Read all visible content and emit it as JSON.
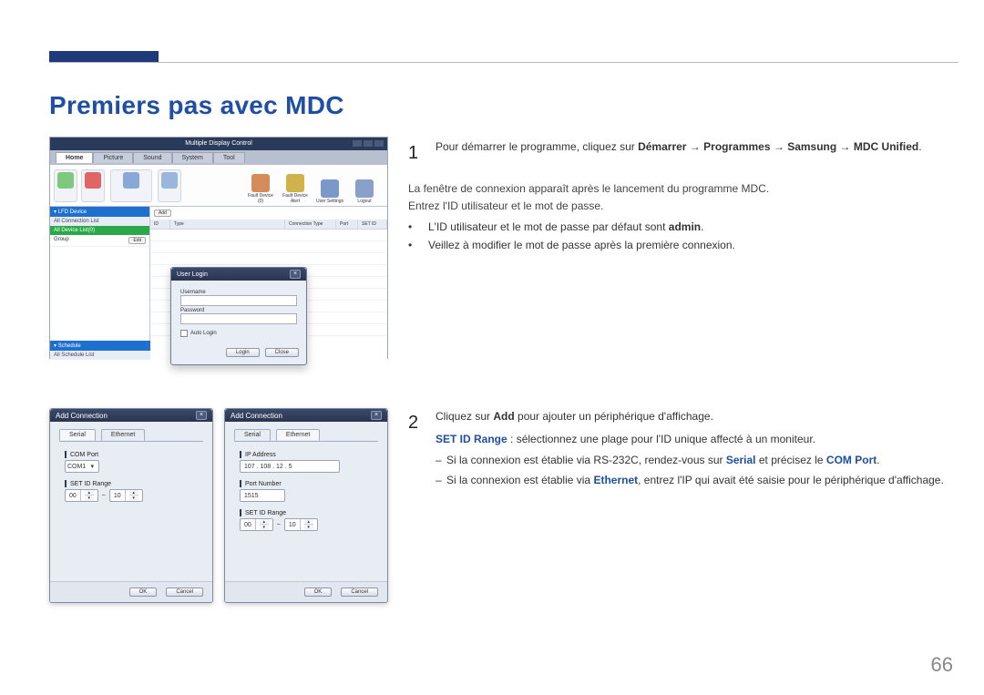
{
  "page": {
    "title": "Premiers pas avec MDC",
    "number": "66"
  },
  "mdc": {
    "window_title": "Multiple Display Control",
    "tabs": [
      "Home",
      "Picture",
      "Sound",
      "System",
      "Tool"
    ],
    "toolbar_right": [
      {
        "label": "Fault Device (0)"
      },
      {
        "label": "Fault Device Alert"
      },
      {
        "label": "User Settings"
      },
      {
        "label": "Logout"
      }
    ],
    "side": {
      "lfd_header": "▾ LFD Device",
      "conn_list": "All Connection List",
      "all_device": "All Device List(0)",
      "group": "Group",
      "edit": "Edit",
      "add": "Add",
      "schedule_header": "▾ Schedule",
      "schedule_list": "All Schedule List"
    },
    "grid_headers": {
      "id": "ID",
      "type": "Type",
      "connection": "Connection Type",
      "port": "Port",
      "setid": "SET ID"
    },
    "login": {
      "title": "User Login",
      "username_label": "Username",
      "password_label": "Password",
      "auto_login": "Auto Login",
      "login_btn": "Login",
      "close_btn": "Close"
    }
  },
  "ac_serial": {
    "title": "Add Connection",
    "tab_serial": "Serial",
    "tab_ethernet": "Ethernet",
    "comport_label": "COM Port",
    "comport_value": "COM1",
    "range_label": "SET ID Range",
    "range_from": "00",
    "range_to": "10",
    "ok": "OK",
    "cancel": "Cancel"
  },
  "ac_eth": {
    "title": "Add Connection",
    "tab_serial": "Serial",
    "tab_ethernet": "Ethernet",
    "ip_label": "IP Address",
    "ip_value": "107 . 108 . 12 . 5",
    "port_label": "Port Number",
    "port_value": "1515",
    "range_label": "SET ID Range",
    "range_from": "00",
    "range_to": "10",
    "ok": "OK",
    "cancel": "Cancel"
  },
  "text": {
    "step1": {
      "num": "1",
      "line1_a": "Pour démarrer le programme, cliquez sur ",
      "line1_b": "Démarrer",
      "arrow": " → ",
      "line1_c": "Programmes",
      "line1_d": "Samsung",
      "line1_e": "MDC Unified",
      "line1_end": ".",
      "p2": "La fenêtre de connexion apparaît après le lancement du programme MDC.",
      "p3": "Entrez l'ID utilisateur et le mot de passe.",
      "b1_a": "L'ID utilisateur et le mot de passe par défaut sont ",
      "b1_b": "admin",
      "b1_c": ".",
      "b2": "Veillez à modifier le mot de passe après la première connexion."
    },
    "step2": {
      "num": "2",
      "p1_a": "Cliquez sur ",
      "p1_b": "Add",
      "p1_c": " pour ajouter un périphérique d'affichage.",
      "p2_a": "SET ID Range",
      "p2_b": " : sélectionnez une plage pour l'ID unique affecté à un moniteur.",
      "d1_a": "Si la connexion est établie via RS-232C, rendez-vous sur ",
      "d1_b": "Serial",
      "d1_c": " et précisez le ",
      "d1_d": "COM Port",
      "d1_e": ".",
      "d2_a": "Si la connexion est établie via ",
      "d2_b": "Ethernet",
      "d2_c": ", entrez l'IP qui avait été saisie pour le périphérique d'affichage."
    }
  }
}
